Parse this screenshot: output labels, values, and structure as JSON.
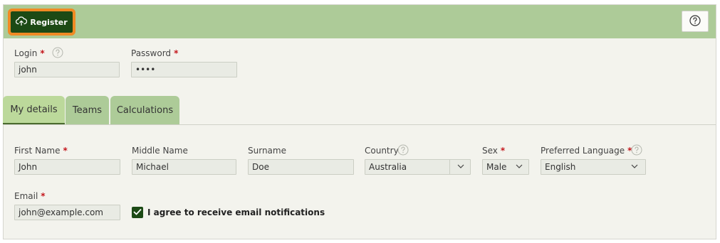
{
  "toolbar": {
    "register_label": "Register",
    "register_icon": "cloud-upload-icon",
    "help_icon": "question-circle-icon"
  },
  "credentials": {
    "login_label": "Login",
    "login_value": "john",
    "password_label": "Password",
    "password_value": "••••"
  },
  "tabs": [
    {
      "label": "My details",
      "active": true
    },
    {
      "label": "Teams",
      "active": false
    },
    {
      "label": "Calculations",
      "active": false
    }
  ],
  "details": {
    "first_name_label": "First Name",
    "first_name_value": "John",
    "middle_name_label": "Middle Name",
    "middle_name_value": "Michael",
    "surname_label": "Surname",
    "surname_value": "Doe",
    "country_label": "Country",
    "country_value": "Australia",
    "sex_label": "Sex",
    "sex_value": "Male",
    "language_label": "Preferred Language",
    "language_value": "English",
    "email_label": "Email",
    "email_value": "john@example.com",
    "notifications_label": "I agree to receive email notifications",
    "notifications_checked": true
  },
  "colors": {
    "toolbar_bg": "#adcb98",
    "button_bg": "#1c4a15",
    "button_outline": "#f08a24",
    "required": "#c4161c"
  }
}
